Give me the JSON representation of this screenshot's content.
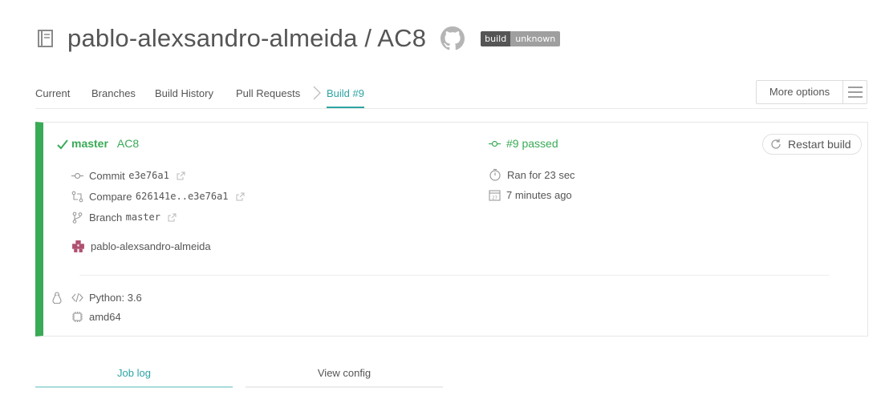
{
  "header": {
    "title": "pablo-alexsandro-almeida / AC8",
    "badge_left": "build",
    "badge_right": "unknown",
    "repo_icon": "book-icon",
    "github_icon": "github-icon"
  },
  "tabs": {
    "current": "Current",
    "branches": "Branches",
    "build_history": "Build History",
    "pull_requests": "Pull Requests",
    "build": "Build #9"
  },
  "more_options": {
    "label": "More options"
  },
  "build": {
    "branch": "master",
    "commit_message": "AC8",
    "status": "#9 passed",
    "commit_label": "Commit",
    "commit_sha": "e3e76a1",
    "compare_label": "Compare",
    "compare_range": "626141e..e3e76a1",
    "branch_label": "Branch",
    "branch_value": "master",
    "author": "pablo-alexsandro-almeida",
    "duration": "Ran for 23 sec",
    "finished": "7 minutes ago",
    "restart_label": "Restart build",
    "language": "Python: 3.6",
    "arch": "amd64"
  },
  "bottom_tabs": {
    "job_log": "Job log",
    "view_config": "View config"
  },
  "colors": {
    "passed": "#39aa56",
    "accent": "#2ea3a3",
    "badge_dark": "#555555",
    "badge_light": "#9f9f9f"
  }
}
